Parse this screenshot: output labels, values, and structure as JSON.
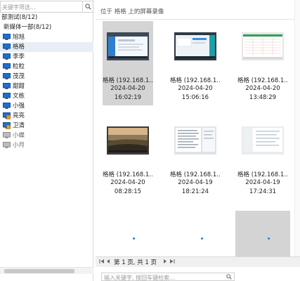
{
  "left_panel": {
    "search_placeholder": "关键字筛选...",
    "groups": [
      {
        "label": "部测试(8/12)"
      },
      {
        "label": "新媒体一部(8/12)"
      }
    ],
    "users": [
      {
        "label": "旭旭",
        "status": "online",
        "selected": false
      },
      {
        "label": "格格",
        "status": "online",
        "selected": true
      },
      {
        "label": "李李",
        "status": "online",
        "selected": false
      },
      {
        "label": "粒粒",
        "status": "online",
        "selected": false
      },
      {
        "label": "茂茂",
        "status": "online",
        "selected": false
      },
      {
        "label": "甜甜",
        "status": "online",
        "selected": false
      },
      {
        "label": "文栋",
        "status": "online",
        "selected": false
      },
      {
        "label": "小强",
        "status": "online",
        "selected": false
      },
      {
        "label": "亮亮",
        "status": "locked",
        "selected": false
      },
      {
        "label": "卫清",
        "status": "locked",
        "selected": false
      },
      {
        "label": "小蝶",
        "status": "offline",
        "selected": false
      },
      {
        "label": "小月",
        "status": "offline",
        "selected": false
      }
    ]
  },
  "main": {
    "breadcrumb": "位于 格格 上的屏幕录像",
    "recordings": [
      {
        "title": "格格 (192.168.1...",
        "date": "2024-04-20",
        "time": "16:02:19",
        "selected": true,
        "thumb": "screen-blue"
      },
      {
        "title": "格格 (192.168.1...",
        "date": "2024-04-20",
        "time": "15:06:16",
        "selected": false,
        "thumb": "screen-teal"
      },
      {
        "title": "格格 (192.168.1...",
        "date": "2024-04-20",
        "time": "13:48:29",
        "selected": false,
        "thumb": "screen-sheet"
      },
      {
        "title": "格格 (192.168.1...",
        "date": "2024-04-20",
        "time": "08:28:15",
        "selected": false,
        "thumb": "landscape"
      },
      {
        "title": "格格 (192.168.1...",
        "date": "2024-04-19",
        "time": "18:21:24",
        "selected": false,
        "thumb": "screen-doc"
      },
      {
        "title": "格格 (192.168.1...",
        "date": "2024-04-19",
        "time": "17:24:31",
        "selected": false,
        "thumb": "screen-files"
      }
    ],
    "loading_items": 3,
    "pager": {
      "page_text": "第 1 页, 共 1 页",
      "first_icon": "first-page-icon",
      "prev_icon": "prev-page-icon",
      "next_icon": "next-page-icon",
      "last_icon": "last-page-icon"
    },
    "bottom_search_placeholder": "输入关键字, 按回车键检索..."
  },
  "colors": {
    "selection_gray": "#d4d4d4",
    "tree_selection": "#e8eef5",
    "accent_blue": "#2b7bd6"
  }
}
